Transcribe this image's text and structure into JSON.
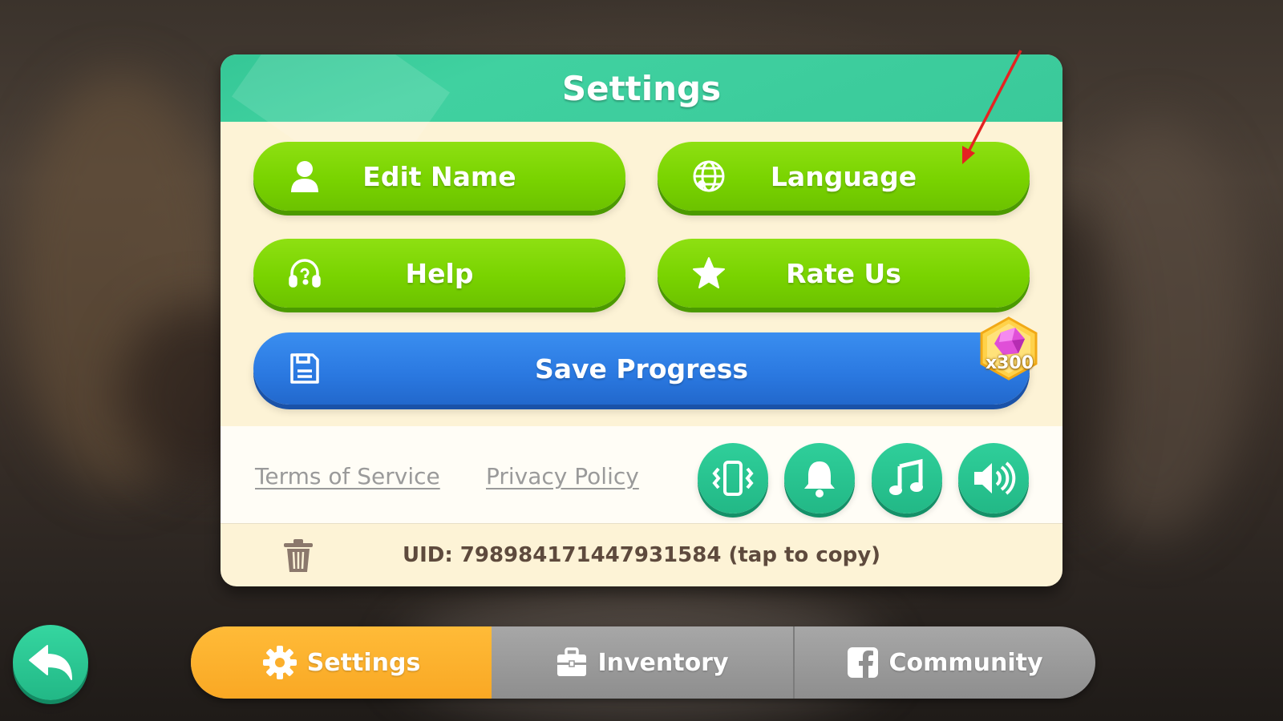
{
  "panel": {
    "title": "Settings"
  },
  "buttons": {
    "edit_name": "Edit Name",
    "language": "Language",
    "help": "Help",
    "rate_us": "Rate Us",
    "save_progress": "Save Progress",
    "save_reward": "x300"
  },
  "links": {
    "terms": "Terms of Service",
    "privacy": "Privacy Policy"
  },
  "toggles": [
    {
      "icon": "vibration-icon"
    },
    {
      "icon": "bell-icon"
    },
    {
      "icon": "music-note-icon"
    },
    {
      "icon": "speaker-icon"
    }
  ],
  "uid": "UID: 798984171447931584 (tap to copy)",
  "tabs": [
    {
      "label": "Settings",
      "icon": "gear-icon",
      "active": true
    },
    {
      "label": "Inventory",
      "icon": "briefcase-icon",
      "active": false
    },
    {
      "label": "Community",
      "icon": "facebook-icon",
      "active": false
    }
  ],
  "colors": {
    "header": "#3ac99a",
    "green_button": "#79d300",
    "blue_button": "#2a78e0",
    "round_button": "#22b886",
    "active_tab": "#f9a824",
    "panel_bg": "#fdf3d6",
    "annotation_arrow": "#e52222"
  }
}
